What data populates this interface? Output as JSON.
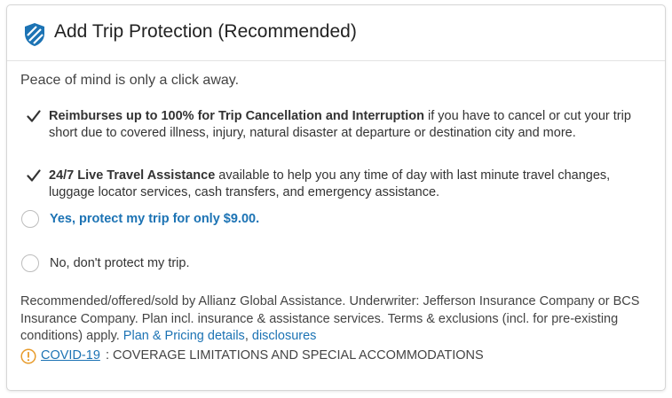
{
  "header": {
    "title": "Add Trip Protection (Recommended)",
    "icon": "shield-icon"
  },
  "subtitle": "Peace of mind is only a click away.",
  "benefits": [
    {
      "icon": "checkmark-icon",
      "bold": "Reimburses up to 100% for Trip Cancellation and Interruption",
      "text": " if you have to cancel or cut your trip short due to covered illness, injury, natural disaster at departure or destination city and more."
    },
    {
      "icon": "checkmark-icon",
      "bold": "24/7 Live Travel Assistance",
      "text": " available to help you any time of day with last minute travel changes, luggage locator services, cash transfers, and emergency assistance."
    }
  ],
  "options": {
    "yes": {
      "label": "Yes, protect my trip for only $9.00.",
      "selected": false
    },
    "no": {
      "label": "No, don't protect my trip.",
      "selected": false
    }
  },
  "disclaimer": {
    "text": "Recommended/offered/sold by Allianz Global Assistance. Underwriter: Jefferson Insurance Company or BCS Insurance Company. Plan incl. insurance & assistance services. Terms & exclusions (incl. for pre-existing conditions) apply. ",
    "link_details": "Plan & Pricing details",
    "separator": ", ",
    "link_disclosures": "disclosures"
  },
  "covid": {
    "icon": "warning-circle-icon",
    "link": "COVID-19",
    "text": ": COVERAGE LIMITATIONS AND SPECIAL ACCOMMODATIONS"
  },
  "colors": {
    "accent": "#1c73b4",
    "shield": "#1c73b4",
    "warning": "#e89b2a",
    "text": "#333333",
    "border": "#d6d6d6"
  }
}
